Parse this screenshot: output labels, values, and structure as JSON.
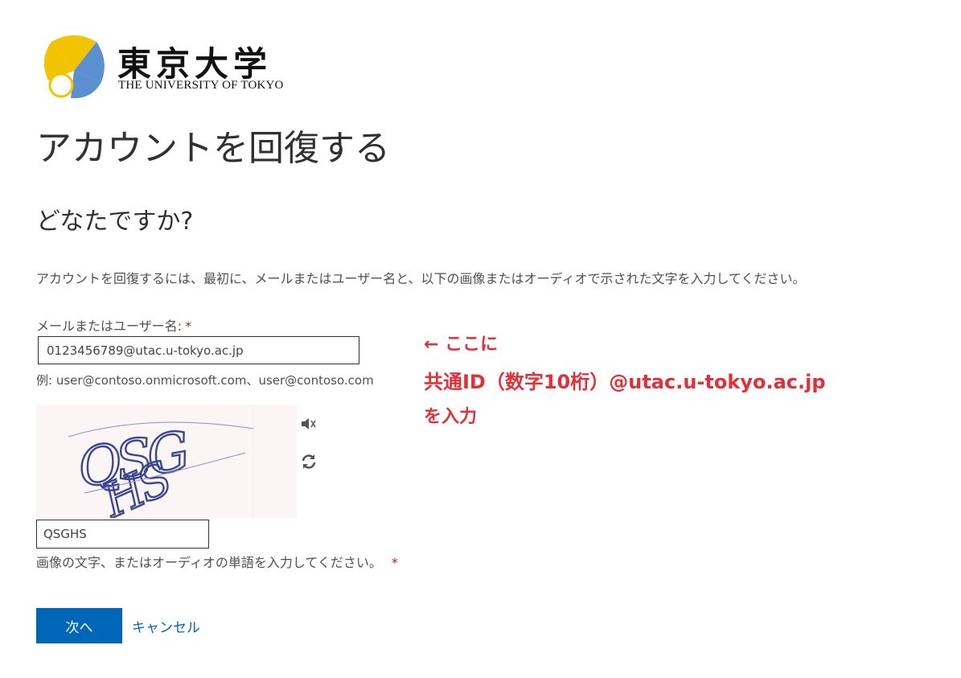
{
  "logo": {
    "name_jp": "東京大学",
    "name_en": "THE UNIVERSITY OF TOKYO",
    "colors": {
      "yellow": "#f2c300",
      "blue": "#5b8fd0"
    }
  },
  "page": {
    "title": "アカウントを回復する",
    "subtitle": "どなたですか?",
    "description": "アカウントを回復するには、最初に、メールまたはユーザー名と、以下の画像またはオーディオで示された文字を入力してください。"
  },
  "email_field": {
    "label": "メールまたはユーザー名:",
    "required_mark": "*",
    "value": "0123456789@utac.u-tokyo.ac.jp",
    "example": "例: user@contoso.onmicrosoft.com、user@contoso.com"
  },
  "captcha": {
    "image_text": "QSGHS",
    "audio_icon": "speaker-icon",
    "refresh_icon": "refresh-icon",
    "input_value": "QSGHS",
    "help_text": "画像の文字、またはオーディオの単語を入力してください。",
    "required_mark": "*"
  },
  "actions": {
    "next_label": "次へ",
    "cancel_label": "キャンセル",
    "accent_color": "#0067b8"
  },
  "annotation": {
    "line1": "← ここに",
    "line2": "共通ID（数字10桁）@utac.u-tokyo.ac.jp",
    "line3": "を入力",
    "color": "#e0313b"
  }
}
